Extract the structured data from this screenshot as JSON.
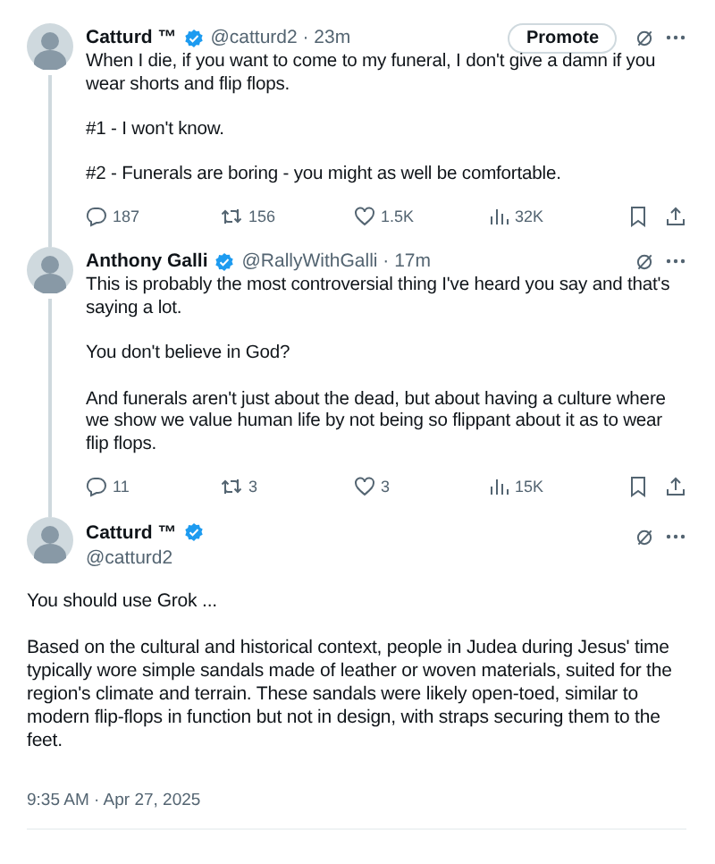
{
  "thread": [
    {
      "name": "Catturd ™",
      "meta": "@catturd2 · 23m",
      "promote": "Promote",
      "paragraphs": [
        "When I die, if you want to come to my funeral, I don't give a damn if you wear shorts and flip flops.",
        "#1 - I won't know.",
        "#2 - Funerals are boring - you might as well be comfortable."
      ],
      "stats": {
        "replies": "187",
        "reposts": "156",
        "likes": "1.5K",
        "views": "32K"
      }
    },
    {
      "name": "Anthony Galli",
      "meta": "@RallyWithGalli · 17m",
      "paragraphs": [
        "This is probably the most controversial thing I've heard you say and that's saying a lot.",
        "You don't believe in God?",
        "And funerals aren't just about the dead, but about having a culture where we show we value human life by not being so flippant about it as to wear flip flops."
      ],
      "stats": {
        "replies": "11",
        "reposts": "3",
        "likes": "3",
        "views": "15K"
      }
    }
  ],
  "main_tweet": {
    "name": "Catturd ™",
    "handle": "@catturd2",
    "paragraphs": [
      "You should use Grok ...",
      "Based on the cultural and historical context, people in Judea during Jesus' time typically wore simple sandals made of leather or woven materials, suited for the region's climate and terrain. These sandals were likely open-toed, similar to modern flip-flops in function but not in design, with straps securing them to the feet."
    ],
    "timestamp": "9:35 AM · Apr 27, 2025"
  }
}
